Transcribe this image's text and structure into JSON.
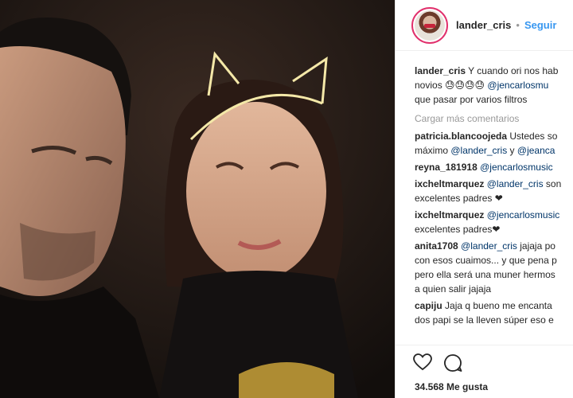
{
  "post": {
    "username": "lander_cris",
    "separator": "•",
    "follow_label": "Seguir",
    "likes": "34.568 Me gusta"
  },
  "caption": {
    "username": "lander_cris",
    "line1": "Y cuando ori nos hab",
    "line2_text": "novios 😓😓😓😓 ",
    "line2_mention": "@jencarlosmu",
    "line3": "que pasar por varios filtros"
  },
  "load_more_label": "Cargar más comentarios",
  "comments": [
    {
      "username": "patricia.blancoojeda",
      "lines": [
        [
          {
            "t": "text",
            "v": " Ustedes so"
          }
        ],
        [
          {
            "t": "text",
            "v": "máximo "
          },
          {
            "t": "mention",
            "v": "@lander_cris"
          },
          {
            "t": "text",
            "v": " y "
          },
          {
            "t": "mention",
            "v": "@jeanca"
          }
        ]
      ]
    },
    {
      "username": "reyna_181918",
      "lines": [
        [
          {
            "t": "text",
            "v": " "
          },
          {
            "t": "mention",
            "v": "@jencarlosmusic"
          }
        ]
      ]
    },
    {
      "username": "ixcheltmarquez",
      "lines": [
        [
          {
            "t": "text",
            "v": " "
          },
          {
            "t": "mention",
            "v": "@lander_cris"
          },
          {
            "t": "text",
            "v": " son"
          }
        ],
        [
          {
            "t": "text",
            "v": "excelentes padres ❤"
          }
        ]
      ]
    },
    {
      "username": "ixcheltmarquez",
      "lines": [
        [
          {
            "t": "text",
            "v": " "
          },
          {
            "t": "mention",
            "v": "@jencarlosmusic"
          }
        ],
        [
          {
            "t": "text",
            "v": "excelentes padres❤"
          }
        ]
      ]
    },
    {
      "username": "anita1708",
      "lines": [
        [
          {
            "t": "text",
            "v": " "
          },
          {
            "t": "mention",
            "v": "@lander_cris"
          },
          {
            "t": "text",
            "v": " jajaja po"
          }
        ],
        [
          {
            "t": "text",
            "v": "con esos cuaimos... y que pena p"
          }
        ],
        [
          {
            "t": "text",
            "v": "pero ella será una muner hermos"
          }
        ],
        [
          {
            "t": "text",
            "v": "a quien salir jajaja"
          }
        ]
      ]
    },
    {
      "username": "capiju",
      "lines": [
        [
          {
            "t": "text",
            "v": " Jaja q bueno me encanta"
          }
        ],
        [
          {
            "t": "text",
            "v": "dos papi se la lleven súper eso e"
          }
        ]
      ]
    }
  ],
  "icons": [
    "heart-icon",
    "comment-icon"
  ],
  "colors": {
    "link": "#3897f0",
    "mention": "#003569",
    "muted": "#999999",
    "text": "#262626"
  }
}
